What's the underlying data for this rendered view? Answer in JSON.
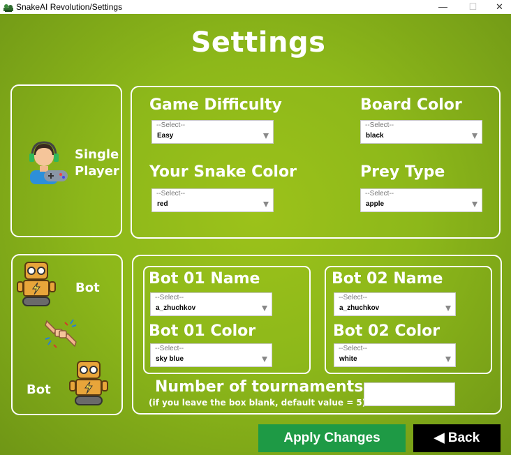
{
  "window": {
    "title": "SnakeAI Revolution/Settings",
    "controls": {
      "minimize": "—",
      "maximize": "☐",
      "close": "✕"
    }
  },
  "page_title": "Settings",
  "single_player": {
    "label_line1": "Single",
    "label_line2": "Player",
    "difficulty": {
      "label": "Game Difficulty",
      "placeholder": "--Select--",
      "value": "Easy"
    },
    "board_color": {
      "label": "Board Color",
      "placeholder": "--Select--",
      "value": "black"
    },
    "snake_color": {
      "label": "Your Snake Color",
      "placeholder": "--Select--",
      "value": "red"
    },
    "prey_type": {
      "label": "Prey Type",
      "placeholder": "--Select--",
      "value": "apple"
    }
  },
  "bot_vs_bot": {
    "label_top": "Bot",
    "label_bottom": "Bot",
    "bot1_name": {
      "label": "Bot 01 Name",
      "placeholder": "--Select--",
      "value": "a_zhuchkov"
    },
    "bot1_color": {
      "label": "Bot 01 Color",
      "placeholder": "--Select--",
      "value": "sky blue"
    },
    "bot2_name": {
      "label": "Bot 02 Name",
      "placeholder": "--Select--",
      "value": "a_zhuchkov"
    },
    "bot2_color": {
      "label": "Bot 02 Color",
      "placeholder": "--Select--",
      "value": "white"
    },
    "tournaments": {
      "label": "Number of tournaments",
      "hint": "(if you leave the box blank, default value = 5)",
      "value": ""
    }
  },
  "buttons": {
    "apply": "Apply Changes",
    "back": "◀ Back"
  },
  "colors": {
    "apply_bg": "#1e9a45",
    "back_bg": "#000000",
    "panel_border": "#ffffff",
    "bg_center": "#9cc21a",
    "bg_edge": "#6f9616"
  }
}
